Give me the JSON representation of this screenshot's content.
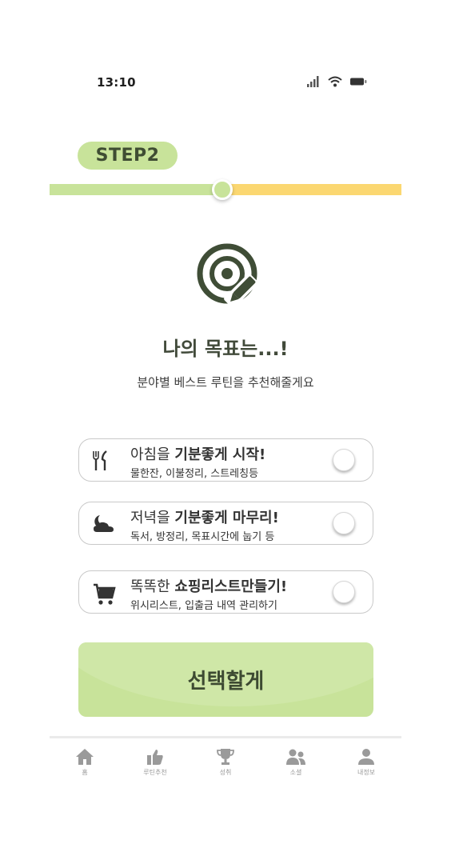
{
  "status_bar": {
    "time": "13:10"
  },
  "step": {
    "label": "STEP2",
    "progress": 0.49
  },
  "heading": "나의 목표는...!",
  "subtitle": "분야별 베스트 루틴을 추천해줄게요",
  "options": [
    {
      "title_normal": "아침을 ",
      "title_bold": "기분좋게 시작!",
      "subtitle": "물한잔, 이불정리, 스트레칭등",
      "icon": "fork-knife-icon",
      "selected": false
    },
    {
      "title_normal": "저녁을 ",
      "title_bold": "기분좋게 마무리!",
      "subtitle": "독서, 방정리, 목표시간에 눕기 등",
      "icon": "night-cloud-icon",
      "selected": false
    },
    {
      "title_normal": "똑똑한 ",
      "title_bold": "쇼핑리스트만들기!",
      "subtitle": "위시리스트, 입출금 내역 관리하기",
      "icon": "cart-icon",
      "selected": false
    }
  ],
  "select_button": "선택할게",
  "nav": [
    {
      "label": "홈",
      "icon": "home-icon"
    },
    {
      "label": "루틴추천",
      "icon": "thumbs-up-icon"
    },
    {
      "label": "성취",
      "icon": "trophy-icon"
    },
    {
      "label": "소셜",
      "icon": "people-icon"
    },
    {
      "label": "내정보",
      "icon": "person-icon"
    }
  ],
  "colors": {
    "accent_green": "#c8e39a",
    "accent_yellow": "#fbd771",
    "dark_text": "#3d4a32",
    "nav_gray": "#9a9a9a"
  }
}
